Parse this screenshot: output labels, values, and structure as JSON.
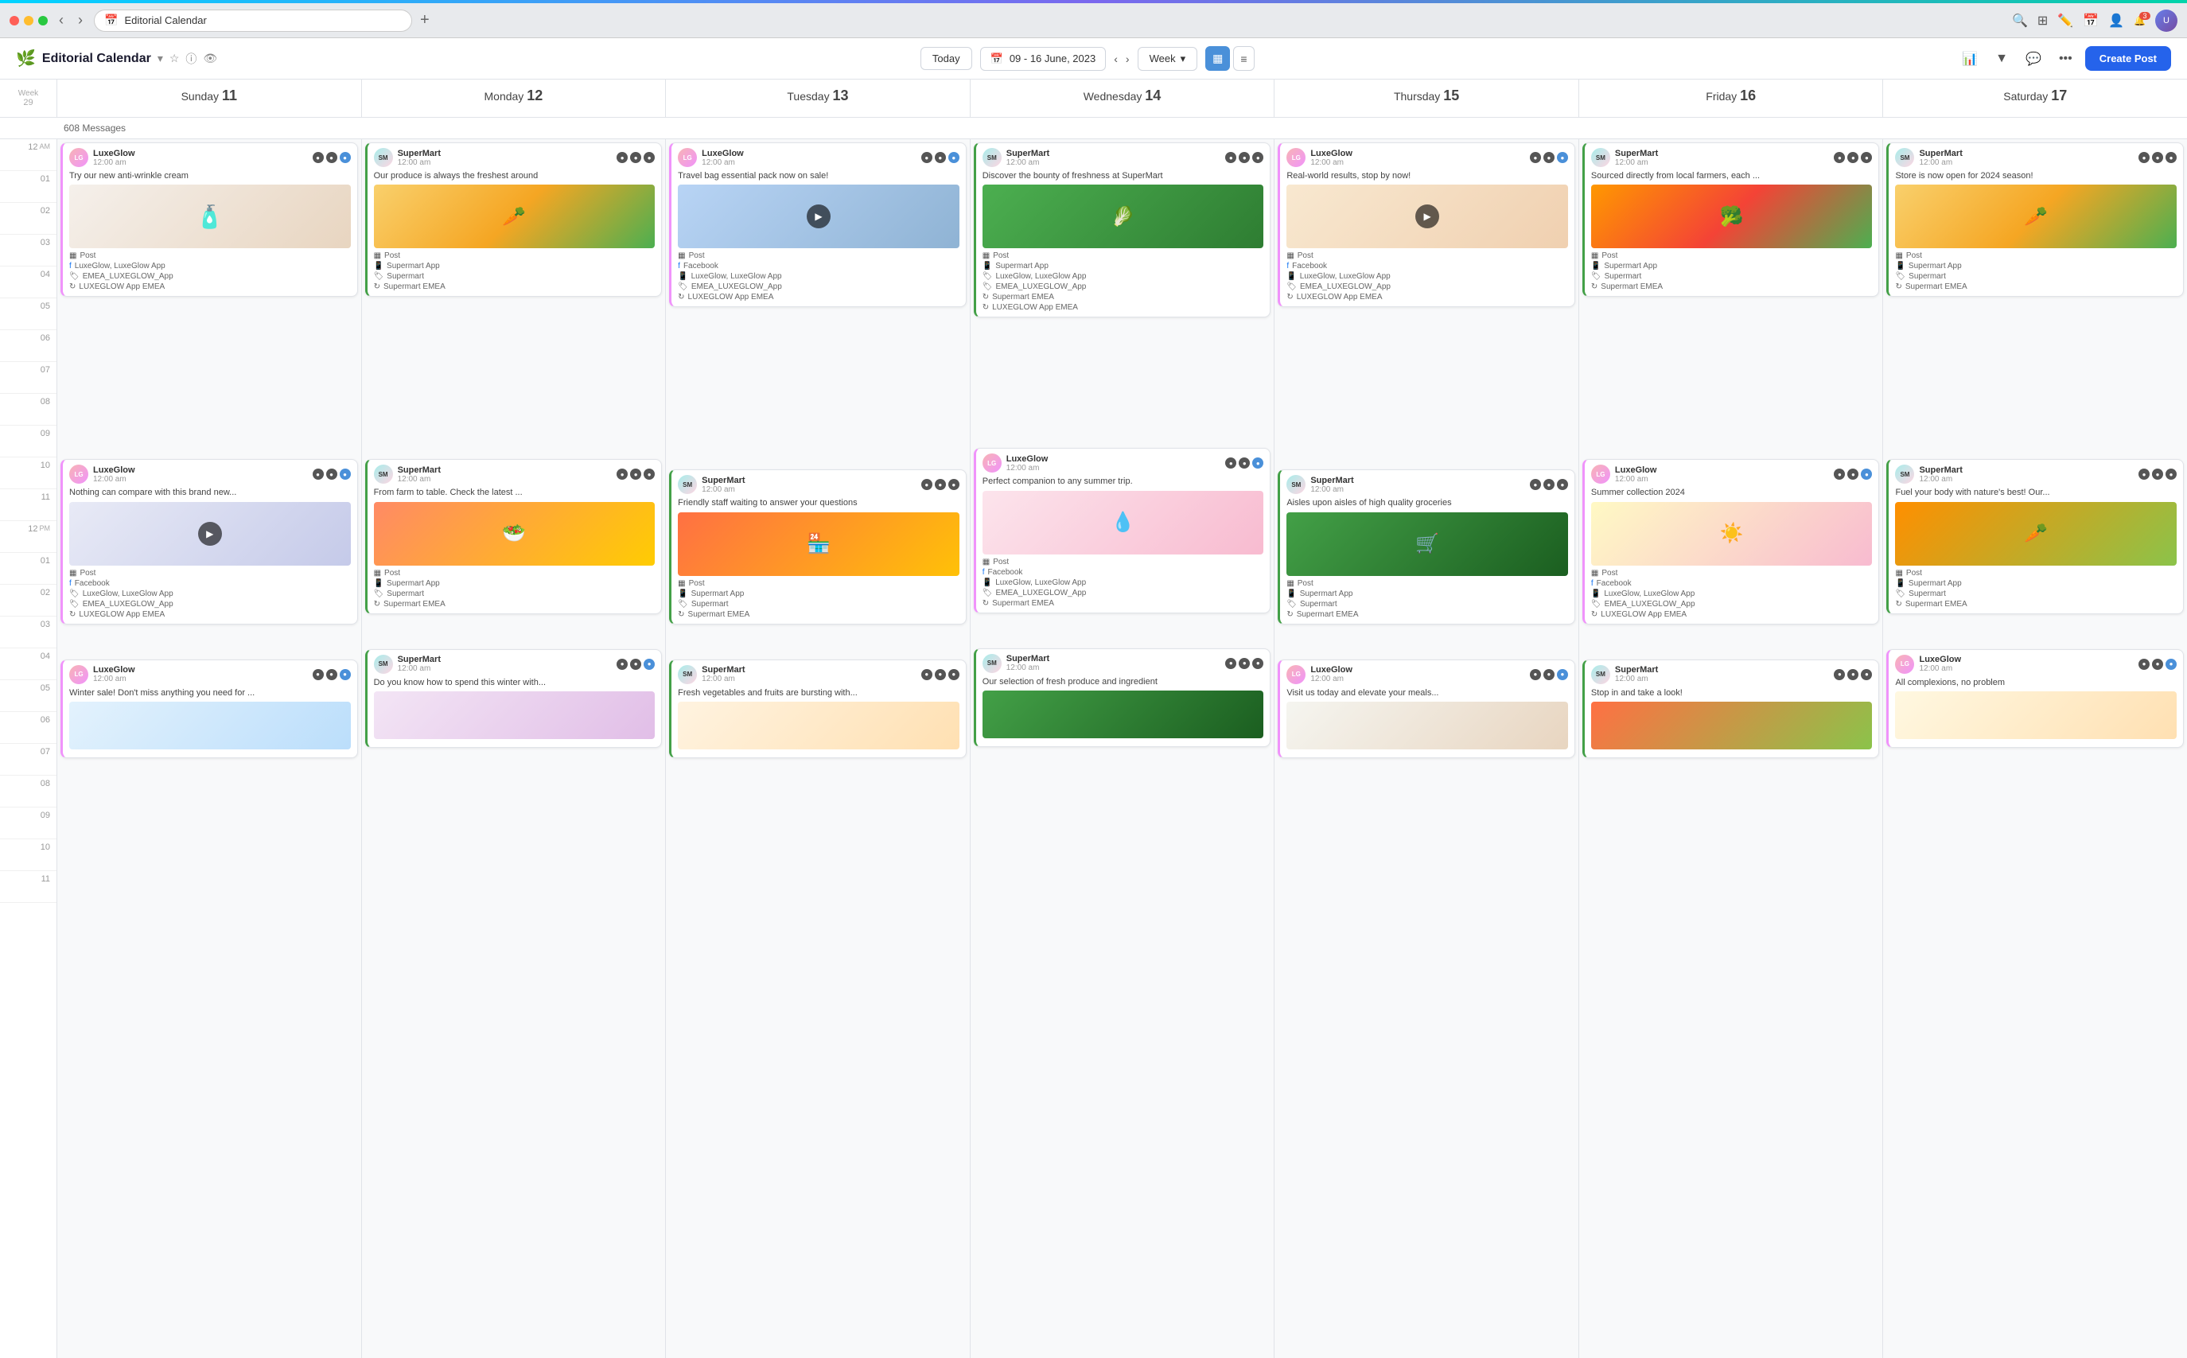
{
  "browser": {
    "url_icon": "📅",
    "url_text": "Editorial Calendar",
    "plus": "+",
    "search_icon": "🔍",
    "grid_icon": "⊞",
    "edit_icon": "✏️",
    "cal_icon": "📅",
    "user_icon": "👤",
    "bell_icon": "🔔",
    "notif_count": "3"
  },
  "header": {
    "title": "Editorial Calendar",
    "today_label": "Today",
    "date_range": "09 - 16 June, 2023",
    "week_label": "Week",
    "create_label": "Create Post",
    "messages_count": "608 Messages"
  },
  "calendar": {
    "week_num": "Week\n29",
    "days": [
      {
        "name": "Sunday",
        "num": "11"
      },
      {
        "name": "Monday",
        "num": "12"
      },
      {
        "name": "Tuesday",
        "num": "13"
      },
      {
        "name": "Wednesday",
        "num": "14"
      },
      {
        "name": "Thursday",
        "num": "15"
      },
      {
        "name": "Friday",
        "num": "16"
      },
      {
        "name": "Saturday",
        "num": "17"
      }
    ],
    "time_slots": [
      {
        "label": "12",
        "period": "AM"
      },
      {
        "label": "01",
        "period": ""
      },
      {
        "label": "02",
        "period": ""
      },
      {
        "label": "03",
        "period": ""
      },
      {
        "label": "04",
        "period": ""
      },
      {
        "label": "05",
        "period": ""
      },
      {
        "label": "06",
        "period": ""
      },
      {
        "label": "07",
        "period": ""
      },
      {
        "label": "08",
        "period": ""
      },
      {
        "label": "09",
        "period": ""
      },
      {
        "label": "10",
        "period": ""
      },
      {
        "label": "11",
        "period": ""
      },
      {
        "label": "12",
        "period": "PM"
      },
      {
        "label": "01",
        "period": ""
      },
      {
        "label": "02",
        "period": ""
      },
      {
        "label": "03",
        "period": ""
      },
      {
        "label": "04",
        "period": ""
      },
      {
        "label": "05",
        "period": ""
      },
      {
        "label": "06",
        "period": ""
      },
      {
        "label": "07",
        "period": ""
      },
      {
        "label": "08",
        "period": ""
      },
      {
        "label": "09",
        "period": ""
      },
      {
        "label": "10",
        "period": ""
      },
      {
        "label": "11",
        "period": ""
      }
    ]
  },
  "posts": {
    "sunday_1": {
      "brand": "LuxeGlow",
      "time": "12:00 am",
      "text": "Try our new anti-wrinkle cream",
      "type": "Post",
      "platform": "Facebook",
      "accounts": [
        "LuxeGlow, LuxeGlow App",
        "EMEA_LUXEGLOW_App",
        "LUXEGLOW App EMEA"
      ]
    },
    "monday_1": {
      "brand": "SuperMart",
      "time": "12:00 am",
      "text": "Our produce is always the freshest around",
      "type": "Post",
      "accounts": [
        "Supermart App",
        "Supermart",
        "Supermart EMEA"
      ]
    },
    "tuesday_1": {
      "brand": "LuxeGlow",
      "time": "12:00 am",
      "text": "Travel bag essential pack now on sale!",
      "type": "Post",
      "platform": "Facebook",
      "accounts": [
        "LuxeGlow, LuxeGlow App",
        "EMEA_LUXEGLOW_App",
        "LUXEGLOW App EMEA"
      ]
    },
    "wednesday_1": {
      "brand": "SuperMart",
      "time": "12:00 am",
      "text": "Discover the bounty of freshness at SuperMart",
      "type": "Post",
      "accounts": [
        "Supermart App",
        "LuxeGlow, LuxeGlow App",
        "Supermart EMEA",
        "LUXEGLOW App EMEA"
      ]
    },
    "thursday_1": {
      "brand": "LuxeGlow",
      "time": "12:00 am",
      "text": "Real-world results, stop by now!",
      "type": "Post",
      "platform": "Facebook",
      "accounts": [
        "LuxeGlow, LuxeGlow App",
        "EMEA_LUXEGLOW_App",
        "LUXEGLOW App EMEA"
      ]
    },
    "friday_1": {
      "brand": "SuperMart",
      "time": "12:00 am",
      "text": "Sourced directly from local farmers, each ...",
      "type": "Post",
      "accounts": [
        "Supermart App",
        "Supermart",
        "Supermart EMEA"
      ]
    },
    "saturday_1": {
      "brand": "SuperMart",
      "time": "12:00 am",
      "text": "Store is now open for 2024 season!",
      "type": "Post",
      "accounts": [
        "Supermart App",
        "Supermart",
        "Supermart EMEA"
      ]
    }
  }
}
